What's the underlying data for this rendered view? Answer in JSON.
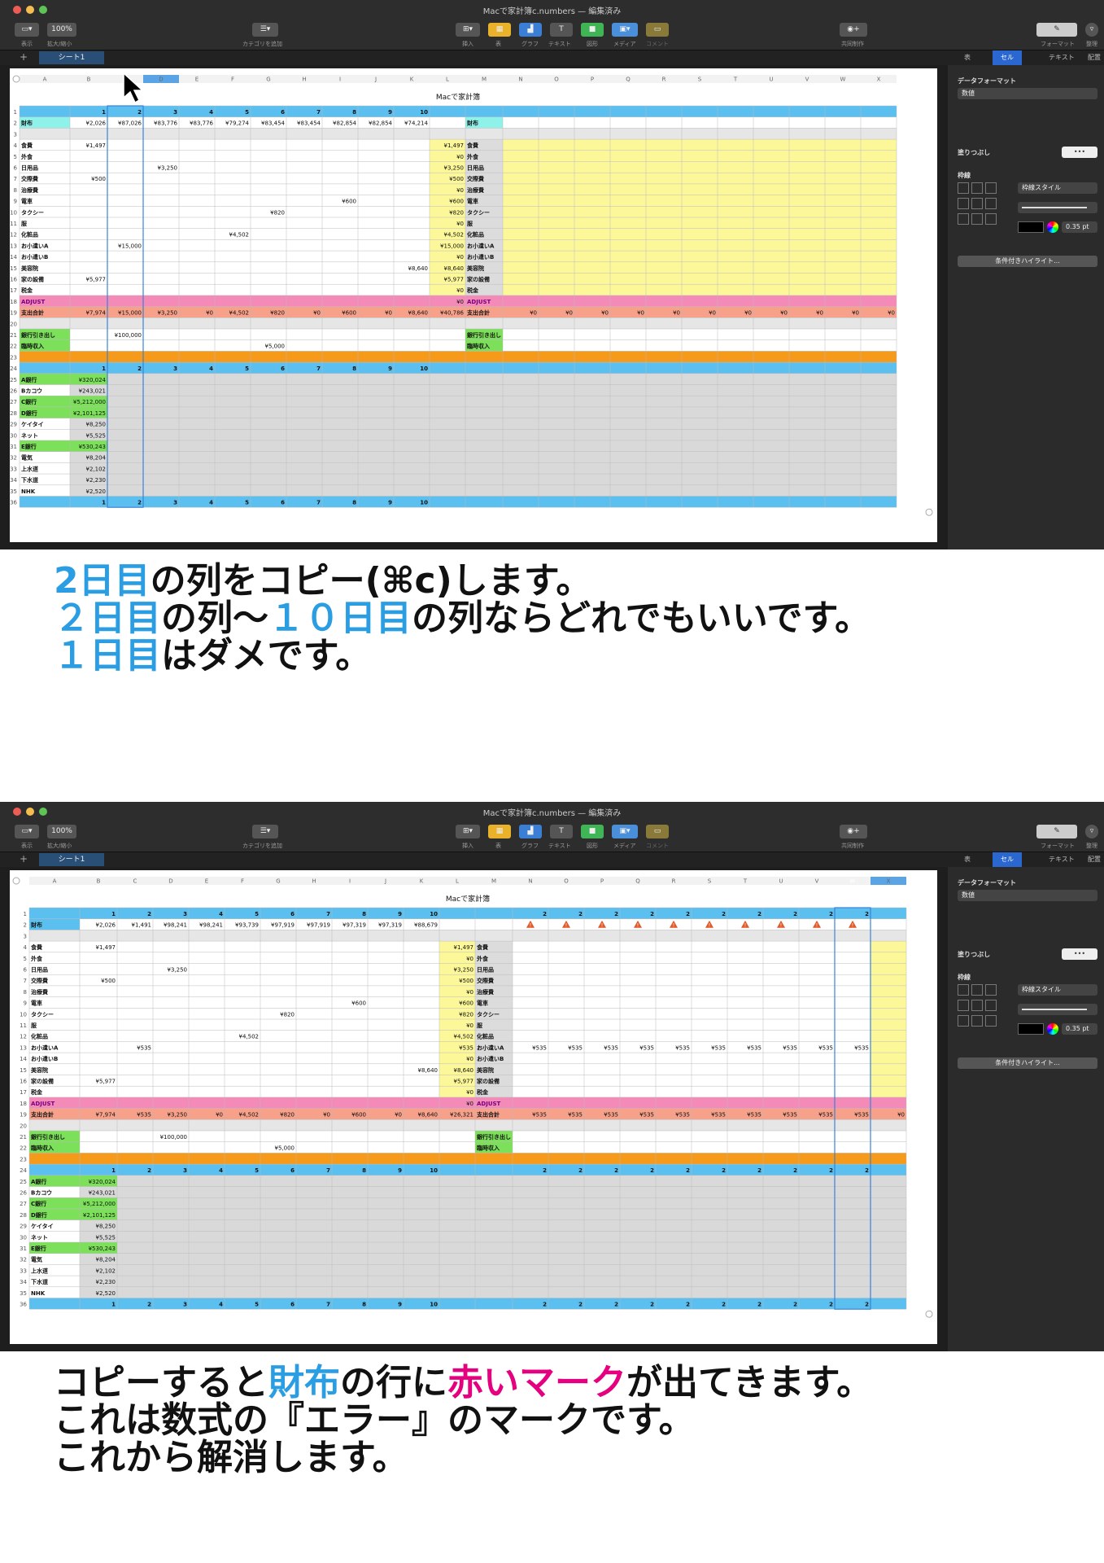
{
  "window": {
    "title": "Macで家計簿c.numbers — 編集済み"
  },
  "toolbar": {
    "view": "表示",
    "zoom_value": "100%",
    "zoom": "拡大/縮小",
    "category": "カテゴリを追加",
    "insert": "挿入",
    "table": "表",
    "chart": "グラフ",
    "text": "テキスト",
    "shape": "図形",
    "media": "メディア",
    "comment": "コメント",
    "collab": "共同制作",
    "format": "フォーマット",
    "organize": "整理"
  },
  "sheet": {
    "tab": "シート1",
    "add": "+"
  },
  "inspector": {
    "tabs": [
      "表",
      "セル",
      "テキスト",
      "配置"
    ],
    "data_format_label": "データフォーマット",
    "data_format_value": "数値",
    "fill_label": "塗りつぶし",
    "border_label": "枠線",
    "border_style": "枠線スタイル",
    "stroke_width": "0.35 pt",
    "conditional": "条件付きハイライト..."
  },
  "spreadsheet": {
    "title": "Macで家計簿",
    "columns": [
      "A",
      "B",
      "C",
      "D",
      "E",
      "F",
      "G",
      "H",
      "I",
      "J",
      "K",
      "L",
      "M",
      "N",
      "O",
      "P",
      "Q",
      "R",
      "S",
      "T",
      "U",
      "V",
      "W",
      "X"
    ],
    "day_headers": [
      "1",
      "2",
      "3",
      "4",
      "5",
      "6",
      "7",
      "8",
      "9",
      "10"
    ],
    "wallet_label": "財布",
    "categories": [
      "食費",
      "外食",
      "日用品",
      "交際費",
      "治療費",
      "電車",
      "タクシー",
      "服",
      "化粧品",
      "お小遣いA",
      "お小遣いB",
      "美容院",
      "家の設備",
      "税金"
    ],
    "adjust": "ADJUST",
    "total_label": "支出合計",
    "bank_out": "銀行引き出し",
    "income": "臨時収入",
    "accounts": [
      [
        "A銀行",
        "¥320,024"
      ],
      [
        "Bカコウ",
        "¥243,021"
      ],
      [
        "C銀行",
        "¥5,212,000"
      ],
      [
        "D銀行",
        "¥2,101,125"
      ],
      [
        "ケイタイ",
        "¥8,250"
      ],
      [
        "ネット",
        "¥5,525"
      ],
      [
        "E銀行",
        "¥530,243"
      ],
      [
        "電気",
        "¥8,204"
      ],
      [
        "上水道",
        "¥2,102"
      ],
      [
        "下水道",
        "¥2,230"
      ],
      [
        "NHK",
        "¥2,520"
      ]
    ],
    "before": {
      "wallet": [
        "¥2,026",
        "¥87,026",
        "¥83,776",
        "¥83,776",
        "¥79,274",
        "¥83,454",
        "¥83,454",
        "¥82,854",
        "¥82,854",
        "¥74,214"
      ],
      "cells": [
        [
          "食費",
          "B",
          "¥1,497"
        ],
        [
          "交際費",
          "B",
          "¥500"
        ],
        [
          "家の設備",
          "B",
          "¥5,977"
        ],
        [
          "日用品",
          "D",
          "¥3,250"
        ],
        [
          "お小遣いA",
          "C",
          "¥15,000"
        ],
        [
          "化粧品",
          "F",
          "¥4,502"
        ],
        [
          "タクシー",
          "G",
          "¥820"
        ],
        [
          "電車",
          "I",
          "¥600"
        ],
        [
          "美容院",
          "K",
          "¥8,640"
        ]
      ],
      "L_values": [
        "¥1,497",
        "¥0",
        "¥3,250",
        "¥500",
        "¥0",
        "¥600",
        "¥820",
        "¥0",
        "¥4,502",
        "¥15,000",
        "¥0",
        "¥8,640",
        "¥5,977",
        "¥0"
      ],
      "adjust_L": "¥0",
      "totals": [
        "¥7,974",
        "¥15,000",
        "¥3,250",
        "¥0",
        "¥4,502",
        "¥820",
        "¥0",
        "¥600",
        "¥0",
        "¥8,640",
        "¥40,786"
      ],
      "right_totals": "¥0",
      "bank_value": "¥100,000",
      "income_value": "¥5,000"
    },
    "after": {
      "wallet": [
        "¥2,026",
        "¥1,491",
        "¥98,241",
        "¥98,241",
        "¥93,739",
        "¥97,919",
        "¥97,919",
        "¥97,319",
        "¥97,319",
        "¥88,679"
      ],
      "right_header": "2",
      "pocket_value": "¥535",
      "L_values": [
        "¥1,497",
        "¥0",
        "¥3,250",
        "¥500",
        "¥0",
        "¥600",
        "¥820",
        "¥0",
        "¥4,502",
        "¥535",
        "¥0",
        "¥8,640",
        "¥5,977",
        "¥0"
      ],
      "adjust_L": "¥0",
      "totals": [
        "¥7,974",
        "¥535",
        "¥3,250",
        "¥0",
        "¥4,502",
        "¥820",
        "¥0",
        "¥600",
        "¥0",
        "¥8,640",
        "¥26,321"
      ],
      "right_totals": "¥535",
      "last_total": "¥0",
      "error_icon": "warning-triangle"
    }
  },
  "captions": {
    "c1": [
      [
        [
          "2日目",
          "blue"
        ],
        [
          "の列をコピー(⌘c)します。",
          ""
        ]
      ],
      [
        [
          "２日目",
          "blue"
        ],
        [
          "の列〜",
          ""
        ],
        [
          "１０日目",
          "blue"
        ],
        [
          "の列ならどれでもいいです。",
          ""
        ]
      ],
      [
        [
          "１日目",
          "blue"
        ],
        [
          "はダメです。",
          ""
        ]
      ]
    ],
    "c2": [
      [
        [
          "コピーすると",
          ""
        ],
        [
          "財布",
          "blue"
        ],
        [
          "の行に",
          ""
        ],
        [
          "赤いマーク",
          "pink"
        ],
        [
          "が出てきます。",
          ""
        ]
      ],
      [
        [
          "これは数式の『エラー』のマークです。",
          ""
        ]
      ],
      [
        [
          "これから解消します。",
          ""
        ]
      ]
    ]
  },
  "colors": {
    "blue_row": "#5bc0f0",
    "salmon": "#f7a08a",
    "pink": "#f48ab8",
    "yellow": "#fcf89a",
    "green": "#7ce05a",
    "orange": "#f59a1a",
    "gray": "#d9d9d9",
    "caption_blue": "#2b9ee3",
    "caption_pink": "#e4007f",
    "error_red": "#e15a2c"
  }
}
